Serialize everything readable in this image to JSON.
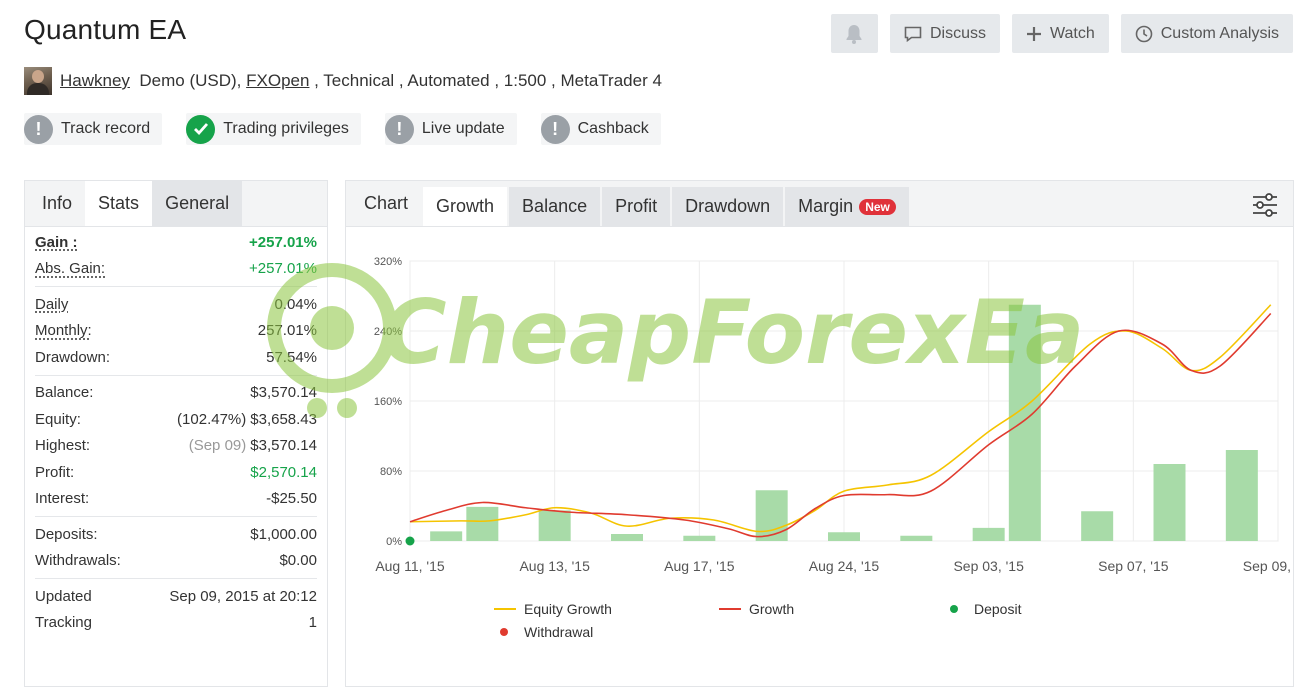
{
  "title": "Quantum EA",
  "header_buttons": {
    "discuss": "Discuss",
    "watch": "Watch",
    "custom": "Custom Analysis"
  },
  "meta": {
    "user": "Hawkney",
    "account": "Demo (USD),",
    "broker": "FXOpen",
    "rest": " , Technical , Automated , 1:500 , MetaTrader 4"
  },
  "badges": [
    "Track record",
    "Trading privileges",
    "Live update",
    "Cashback"
  ],
  "left_tabs": [
    "Info",
    "Stats",
    "General"
  ],
  "stats": {
    "gain_label": "Gain :",
    "gain": "+257.01%",
    "abs_gain_label": "Abs. Gain:",
    "abs_gain": "+257.01%",
    "daily_label": "Daily",
    "daily": "0.04%",
    "monthly_label": "Monthly:",
    "monthly": "257.01%",
    "drawdown_label": "Drawdown:",
    "drawdown": "57.54%",
    "balance_label": "Balance:",
    "balance": "$3,570.14",
    "equity_label": "Equity:",
    "equity_note": "(102.47%)",
    "equity": "$3,658.43",
    "highest_label": "Highest:",
    "highest_note": "(Sep 09)",
    "highest": "$3,570.14",
    "profit_label": "Profit:",
    "profit": "$2,570.14",
    "interest_label": "Interest:",
    "interest": "-$25.50",
    "deposits_label": "Deposits:",
    "deposits": "$1,000.00",
    "withdrawals_label": "Withdrawals:",
    "withdrawals": "$0.00",
    "updated_label": "Updated",
    "updated": "Sep 09, 2015 at 20:12",
    "tracking_label": "Tracking",
    "tracking": "1"
  },
  "chart_tabs": {
    "label": "Chart",
    "items": [
      "Growth",
      "Balance",
      "Profit",
      "Drawdown",
      "Margin"
    ],
    "new_badge": "New"
  },
  "watermark": "CheapForexEa",
  "colors": {
    "equity": "#f5c400",
    "growth": "#e03b2f",
    "deposit": "#16a34a",
    "withdrawal": "#e03b2f",
    "bar": "#a8dba8",
    "green": "#16a34a"
  },
  "chart_data": {
    "type": "line",
    "y_ticks": [
      "320%",
      "240%",
      "160%",
      "80%",
      "0%"
    ],
    "ylim": [
      0,
      320
    ],
    "x_ticks": [
      "Aug 11, '15",
      "Aug 13, '15",
      "Aug 17, '15",
      "Aug 24, '15",
      "Sep 03, '15",
      "Sep 07, '15",
      "Sep 09, '15"
    ],
    "legend": [
      "Equity Growth",
      "Growth",
      "Deposit",
      "Withdrawal"
    ],
    "bars": [
      {
        "x": 0.25,
        "value": 11
      },
      {
        "x": 0.5,
        "value": 39
      },
      {
        "x": 1.0,
        "value": 35
      },
      {
        "x": 1.5,
        "value": 8
      },
      {
        "x": 2.0,
        "value": 6
      },
      {
        "x": 2.5,
        "value": 58
      },
      {
        "x": 3.0,
        "value": 10
      },
      {
        "x": 3.5,
        "value": 6
      },
      {
        "x": 4.0,
        "value": 15
      },
      {
        "x": 4.25,
        "value": 270
      },
      {
        "x": 4.75,
        "value": 34
      },
      {
        "x": 5.25,
        "value": 88
      },
      {
        "x": 5.75,
        "value": 104
      }
    ],
    "series": [
      {
        "name": "Equity Growth",
        "points": [
          [
            0,
            22
          ],
          [
            0.35,
            23
          ],
          [
            0.55,
            23
          ],
          [
            0.8,
            30
          ],
          [
            1.0,
            38
          ],
          [
            1.25,
            32
          ],
          [
            1.5,
            17
          ],
          [
            1.8,
            26
          ],
          [
            2.1,
            24
          ],
          [
            2.4,
            11
          ],
          [
            2.6,
            18
          ],
          [
            2.8,
            35
          ],
          [
            3.0,
            57
          ],
          [
            3.3,
            64
          ],
          [
            3.6,
            75
          ],
          [
            4.0,
            125
          ],
          [
            4.3,
            160
          ],
          [
            4.7,
            225
          ],
          [
            4.95,
            240
          ],
          [
            5.2,
            220
          ],
          [
            5.4,
            195
          ],
          [
            5.6,
            210
          ],
          [
            5.95,
            270
          ]
        ]
      },
      {
        "name": "Growth",
        "points": [
          [
            0,
            22
          ],
          [
            0.25,
            35
          ],
          [
            0.5,
            44
          ],
          [
            0.8,
            38
          ],
          [
            1.1,
            33
          ],
          [
            1.5,
            30
          ],
          [
            1.9,
            24
          ],
          [
            2.2,
            14
          ],
          [
            2.4,
            5
          ],
          [
            2.6,
            13
          ],
          [
            2.8,
            37
          ],
          [
            3.0,
            52
          ],
          [
            3.3,
            53
          ],
          [
            3.6,
            57
          ],
          [
            4.0,
            110
          ],
          [
            4.3,
            145
          ],
          [
            4.6,
            200
          ],
          [
            4.9,
            240
          ],
          [
            5.2,
            225
          ],
          [
            5.4,
            195
          ],
          [
            5.6,
            200
          ],
          [
            5.95,
            260
          ]
        ]
      }
    ],
    "deposit_points": [
      {
        "x": 0,
        "value": 0
      }
    ]
  }
}
